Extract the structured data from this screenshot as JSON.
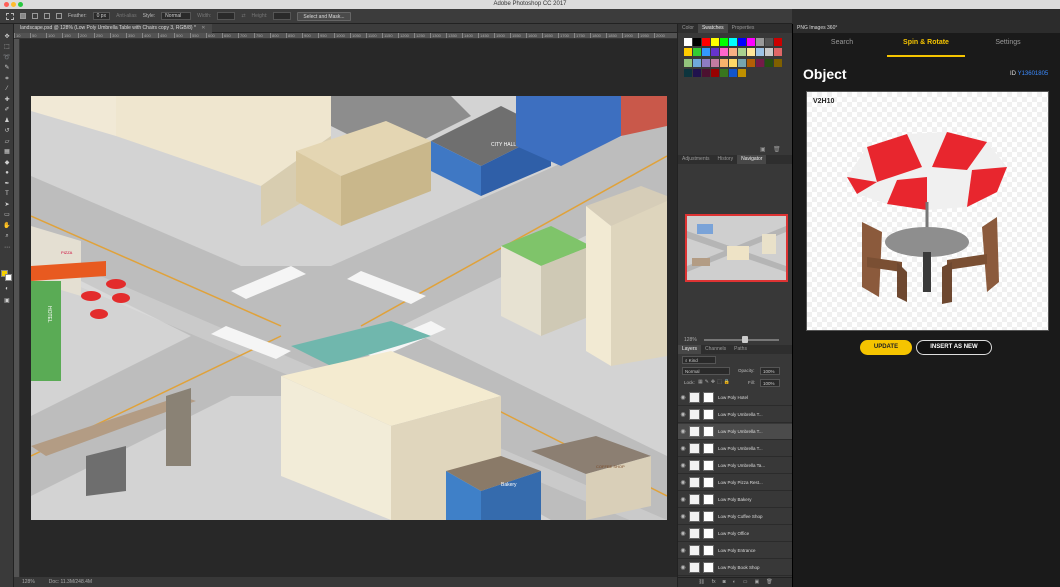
{
  "app": {
    "window_title": "Adobe Photoshop CC 2017"
  },
  "options_bar": {
    "feather_label": "Feather:",
    "feather_value": "0 px",
    "antialias_label": "Anti-alias",
    "style_label": "Style:",
    "style_value": "Normal",
    "width_label": "Width:",
    "height_label": "Height:",
    "select_mask_label": "Select and Mask..."
  },
  "document": {
    "tab_title": "landscape.psd @ 128% (Low Poly Umbrella Table with Chairs copy 3, RGB/8) *",
    "zoom": "128%",
    "doc_size": "Doc: 11.3M/248.4M",
    "ruler_marks": [
      "10",
      "50",
      "100",
      "150",
      "200",
      "250",
      "300",
      "350",
      "400",
      "450",
      "500",
      "550",
      "600",
      "650",
      "700",
      "750",
      "800",
      "850",
      "900",
      "950",
      "1000",
      "1050",
      "1100",
      "1150",
      "1200",
      "1250",
      "1300",
      "1350",
      "1400",
      "1450",
      "1500",
      "1550",
      "1600",
      "1650",
      "1700",
      "1750",
      "1800",
      "1850",
      "1900",
      "1950",
      "2000"
    ]
  },
  "swatches_panel": {
    "tabs": [
      "Color",
      "Swatches",
      "Properties"
    ],
    "active": "Swatches",
    "colors": [
      "#ffffff",
      "#000000",
      "#ff0000",
      "#ffff00",
      "#00ff00",
      "#00ffff",
      "#0000ff",
      "#ff00ff",
      "#999999",
      "#555555",
      "#cc0000",
      "#ffcc00",
      "#33cc33",
      "#3399ff",
      "#6633cc",
      "#ff66cc",
      "#f7b083",
      "#a9d18e",
      "#ffe699",
      "#9dc3e6",
      "#c9c9c9",
      "#e06666",
      "#93c47d",
      "#6fa8dc",
      "#8e7cc3",
      "#c27ba0",
      "#f6b26b",
      "#ffd966",
      "#76a5af",
      "#b45f06",
      "#741b47",
      "#274e13",
      "#7f6000",
      "#0c343d",
      "#20124d",
      "#4c1130",
      "#990000",
      "#38761d",
      "#1155cc",
      "#bf9000"
    ]
  },
  "navigator_panel": {
    "tabs": [
      "Adjustments",
      "History",
      "Navigator"
    ],
    "active": "Navigator",
    "zoom": "128%"
  },
  "layers_panel": {
    "tabs": [
      "Layers",
      "Channels",
      "Paths"
    ],
    "active": "Layers",
    "filter_label": "Kind",
    "blend_mode": "Normal",
    "opacity_label": "Opacity:",
    "opacity_value": "100%",
    "lock_label": "Lock:",
    "fill_label": "Fill:",
    "fill_value": "100%",
    "layers": [
      {
        "name": "Low Poly Hotel"
      },
      {
        "name": "Low Poly Umbrella T..."
      },
      {
        "name": "Low Poly Umbrella T..."
      },
      {
        "name": "Low Poly Umbrella T..."
      },
      {
        "name": "Low Poly Umbrella Ta..."
      },
      {
        "name": "Low Poly Pizza Rest..."
      },
      {
        "name": "Low Poly Bakery"
      },
      {
        "name": "Low Poly Coffee Shop"
      },
      {
        "name": "Low Poly Office"
      },
      {
        "name": "Low Poly Entrance"
      },
      {
        "name": "Low Poly Book Shop"
      }
    ]
  },
  "plugin": {
    "header": "PNG Images 360°",
    "tabs": [
      "Search",
      "Spin & Rotate",
      "Settings"
    ],
    "active_tab": "Spin & Rotate",
    "accent_color": "#f5c400",
    "object_heading": "Object",
    "id_label": "ID",
    "id_value": "Y13601805",
    "view_code": "V2H10",
    "update_button": "UPDATE",
    "insert_button": "INSERT AS NEW"
  },
  "scene_labels": {
    "city_hall": "CITY HALL",
    "hotel": "HOTEL",
    "pizza": "PIZZA",
    "bakery": "Bakery",
    "coffee": "COFFEE SHOP"
  }
}
